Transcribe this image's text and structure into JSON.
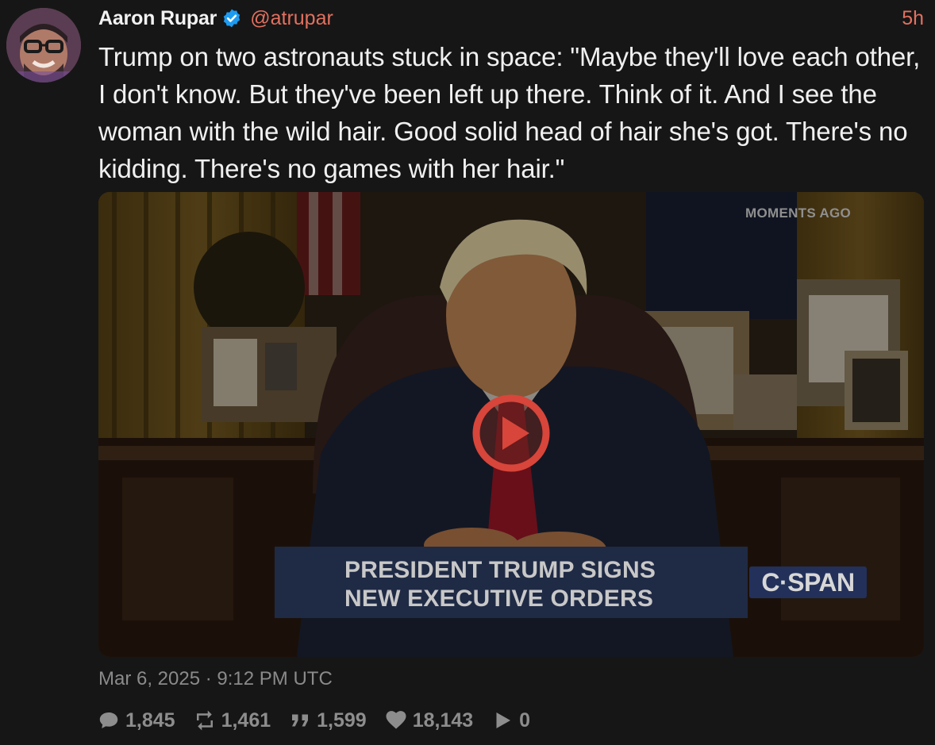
{
  "author": {
    "display_name": "Aaron Rupar",
    "handle": "@atrupar",
    "verified_icon": "verified-badge-icon",
    "avatar_icon": "avatar"
  },
  "post": {
    "relative_time": "5h",
    "text": "Trump on two astronauts stuck in space: \"Maybe they'll love each other, I don't know. But they've been left up there. Think of it. And I see the woman with the wild hair. Good solid head of hair she's got. There's no kidding. There's no games with her hair.\"",
    "timestamp": "Mar 6, 2025 · 9:12 PM UTC"
  },
  "media": {
    "overlay_label": "MOMENTS AGO",
    "chyron_line_1": "PRESIDENT TRUMP SIGNS",
    "chyron_line_2": "NEW EXECUTIVE ORDERS",
    "network_logo": "C·SPAN",
    "play_icon": "play-icon"
  },
  "stats": {
    "replies": "1,845",
    "retweets": "1,461",
    "quotes": "1,599",
    "likes": "18,143",
    "views": "0"
  },
  "colors": {
    "background": "#161616",
    "accent": "#e2705f",
    "verified_blue": "#1d9bf0",
    "muted_text": "#8a8a8a",
    "play_red": "#d8453a"
  }
}
